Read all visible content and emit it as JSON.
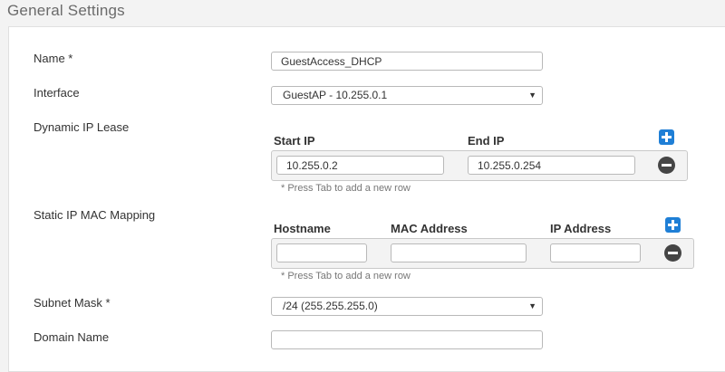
{
  "section": {
    "title": "General Settings"
  },
  "fields": {
    "name": {
      "label": "Name *",
      "value": "GuestAccess_DHCP"
    },
    "interface": {
      "label": "Interface",
      "value": "GuestAP - 10.255.0.1"
    },
    "dynamic_ip_lease": {
      "label": "Dynamic IP Lease",
      "columns": [
        "Start IP",
        "End IP"
      ],
      "rows": [
        {
          "start_ip": "10.255.0.2",
          "end_ip": "10.255.0.254"
        }
      ],
      "hint": "* Press Tab to add a new row"
    },
    "static_ip_mac_mapping": {
      "label": "Static IP MAC Mapping",
      "columns": [
        "Hostname",
        "MAC Address",
        "IP Address"
      ],
      "rows": [
        {
          "hostname": "",
          "mac_address": "",
          "ip_address": ""
        }
      ],
      "hint": "* Press Tab to add a new row"
    },
    "subnet_mask": {
      "label": "Subnet Mask *",
      "value": "/24 (255.255.255.0)"
    },
    "domain_name": {
      "label": "Domain Name",
      "value": ""
    }
  },
  "colors": {
    "accent": "#1f7fd6",
    "remove": "#454545"
  },
  "icons": {
    "add": "plus-square-icon",
    "remove": "minus-circle-icon",
    "dropdown": "caret-down-icon"
  }
}
